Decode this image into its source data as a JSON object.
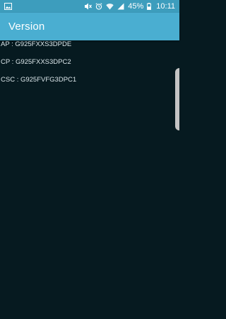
{
  "status_bar": {
    "time": "10:11",
    "battery_percent": "45%",
    "icons": [
      "gallery-icon",
      "mute-icon",
      "alarm-icon",
      "wifi-icon",
      "signal-icon",
      "battery-icon"
    ]
  },
  "app_bar": {
    "title": "Version"
  },
  "versions": [
    {
      "text": "AP : G925FXXS3DPDE"
    },
    {
      "text": "CP : G925FXXS3DPC2"
    },
    {
      "text": "CSC : G925FVFG3DPC1"
    }
  ],
  "colors": {
    "status_bar": "#3d9dbd",
    "app_bar": "#4aaed1",
    "background": "#061a20",
    "text": "#dbe6ea"
  }
}
